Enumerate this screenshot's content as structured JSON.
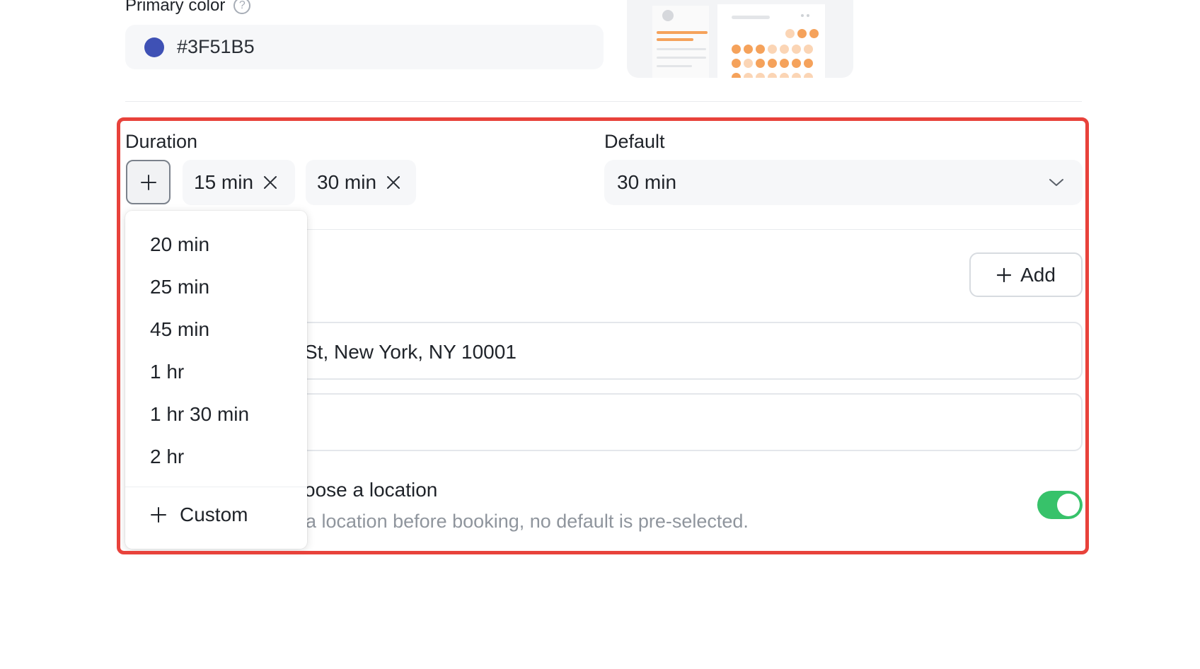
{
  "primary_color": {
    "label": "Primary color",
    "help_icon": "question-circle-icon",
    "value": "#3F51B5",
    "swatch_color": "#3F51B5"
  },
  "preview": {
    "accent": "#F5A25B",
    "accent_light": "#FBD5B5"
  },
  "duration": {
    "label": "Duration",
    "add_icon": "plus-icon",
    "selected": [
      {
        "label": "15 min",
        "remove_icon": "close-icon"
      },
      {
        "label": "30 min",
        "remove_icon": "close-icon"
      }
    ],
    "options": [
      "20 min",
      "25 min",
      "45 min",
      "1 hr",
      "1 hr 30 min",
      "2 hr"
    ],
    "custom_label": "Custom"
  },
  "default": {
    "label": "Default",
    "value": "30 min",
    "icon": "chevron-down-icon"
  },
  "location": {
    "add_label": "Add",
    "address_visible": "St, New York, NY 10001",
    "choose_title_visible": "oose a location",
    "choose_desc_visible": "a location before booking, no default is pre-selected.",
    "toggle_on": true
  },
  "colors": {
    "highlight": "#E8423B",
    "toggle_on": "#37C26A"
  }
}
